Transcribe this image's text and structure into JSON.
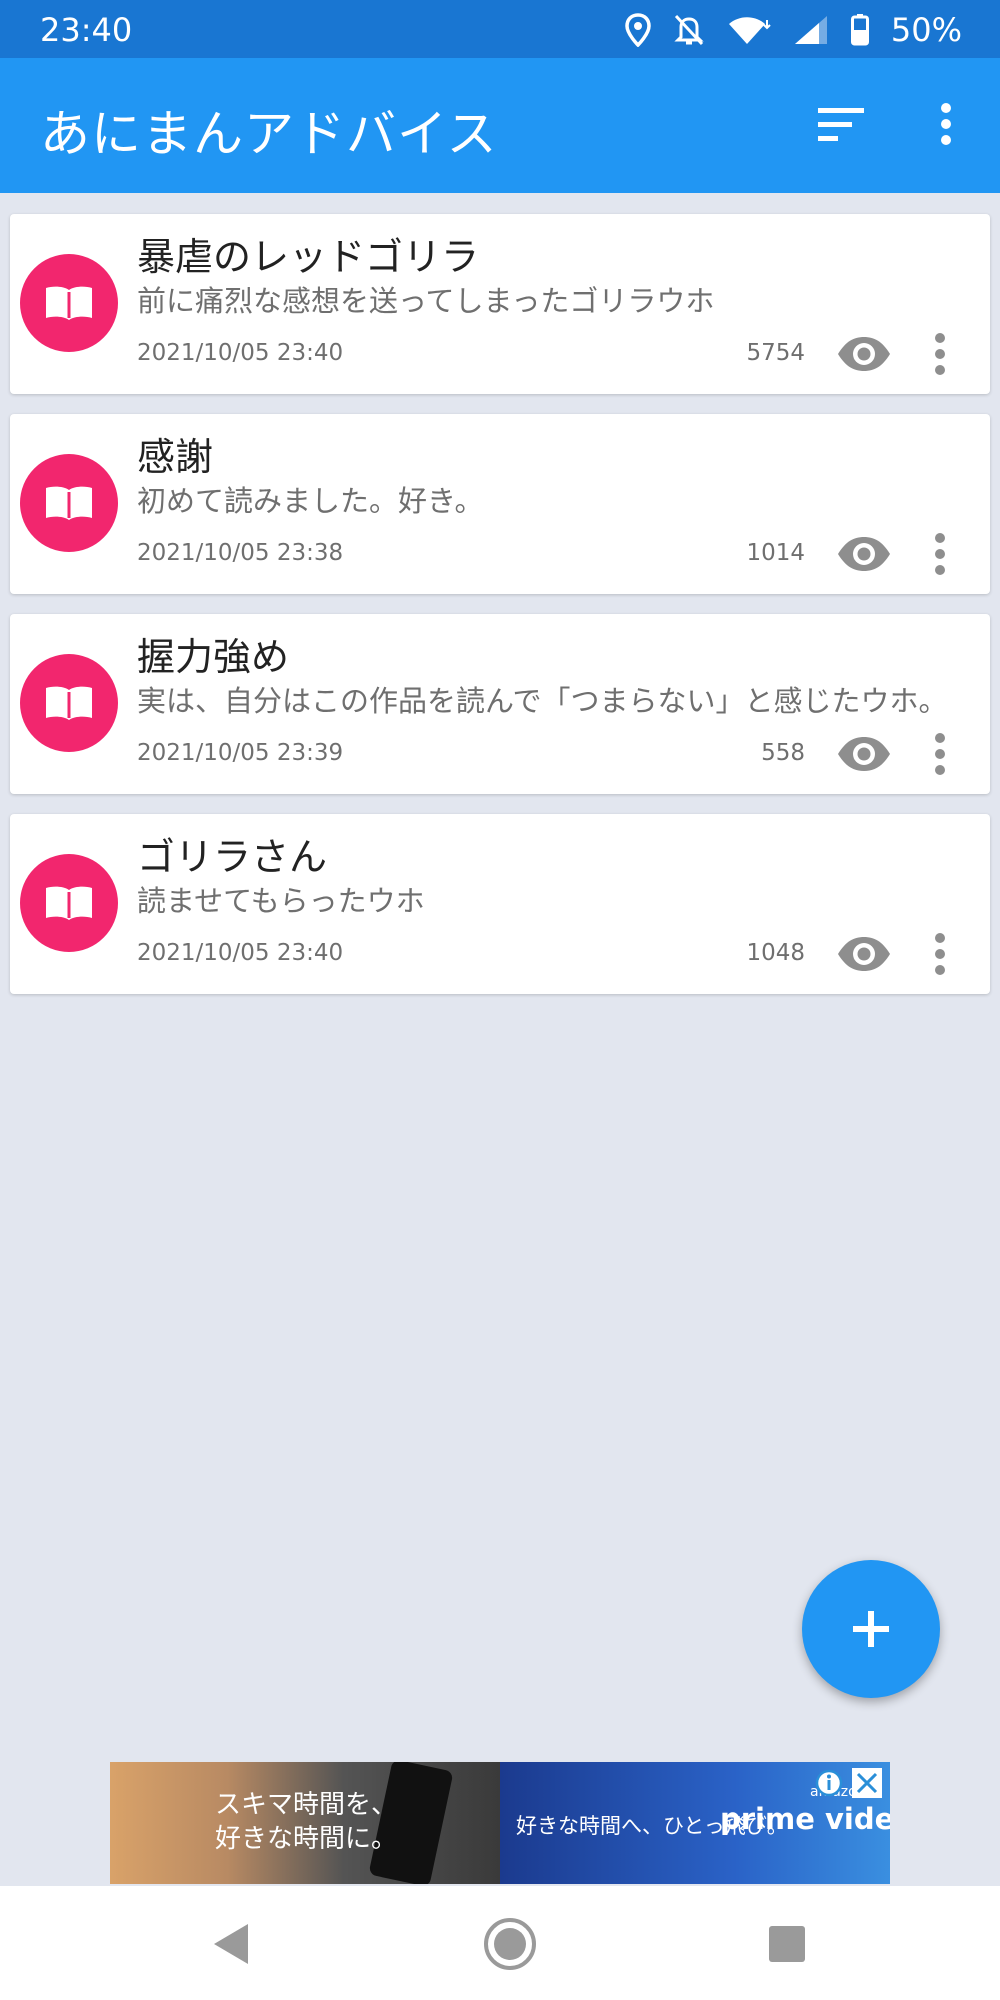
{
  "status_bar": {
    "time": "23:40",
    "battery": "50%"
  },
  "app_bar": {
    "title": "あにまんアドバイス"
  },
  "posts": [
    {
      "title": "暴虐のレッドゴリラ",
      "body": "前に痛烈な感想を送ってしまったゴリラウホ",
      "date": "2021/10/05 23:40",
      "views": "5754"
    },
    {
      "title": "感謝",
      "body": "初めて読みました。好き。",
      "date": "2021/10/05 23:38",
      "views": "1014"
    },
    {
      "title": "握力強め",
      "body": "実は、自分はこの作品を読んで「つまらない」と感じたウホ。",
      "date": "2021/10/05 23:39",
      "views": "558"
    },
    {
      "title": "ゴリラさん",
      "body": "読ませてもらったウホ",
      "date": "2021/10/05 23:40",
      "views": "1048"
    }
  ],
  "ad": {
    "left_line1": "スキマ時間を、",
    "left_line2": "好きな時間に。",
    "right_text": "好きな時間へ、ひとっ飛び。",
    "brand_small": "amazon",
    "brand": "prime video"
  },
  "colors": {
    "primary": "#2196f3",
    "primary_dark": "#1976d2",
    "accent": "#f2266e",
    "background": "#e2e6ef"
  },
  "icons": {
    "app_bar": [
      "sort-icon",
      "more-vert-icon"
    ],
    "card": [
      "book-icon",
      "eye-icon",
      "more-vert-icon"
    ],
    "fab": "plus-icon",
    "nav": [
      "back-icon",
      "home-icon",
      "recents-icon"
    ]
  }
}
